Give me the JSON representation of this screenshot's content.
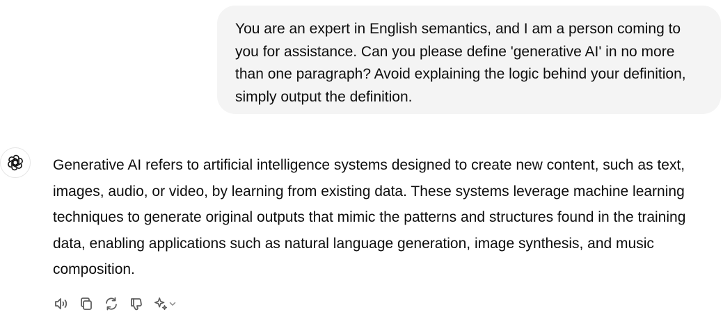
{
  "user_message": {
    "text": "You are an expert in English semantics, and I am a person coming to you for assistance. Can you please define 'generative AI' in no more than one paragraph? Avoid explaining the logic behind your definition, simply output the definition."
  },
  "assistant_message": {
    "avatar_icon": "openai-logo-icon",
    "text": "Generative AI refers to artificial intelligence systems designed to create new content, such as text, images, audio, or video, by learning from existing data. These systems leverage machine learning techniques to generate original outputs that mimic the patterns and structures found in the training data, enabling applications such as natural language generation, image synthesis, and music composition."
  },
  "actions": [
    {
      "name": "read-aloud",
      "icon": "speaker-icon"
    },
    {
      "name": "copy",
      "icon": "copy-icon"
    },
    {
      "name": "regenerate",
      "icon": "refresh-icon"
    },
    {
      "name": "bad-response",
      "icon": "thumbs-down-icon"
    },
    {
      "name": "switch-model",
      "icon": "sparkle-icon"
    }
  ],
  "colors": {
    "bubble_bg": "#f4f4f4",
    "text": "#0d0d0d",
    "icon": "#5d5d5d"
  }
}
